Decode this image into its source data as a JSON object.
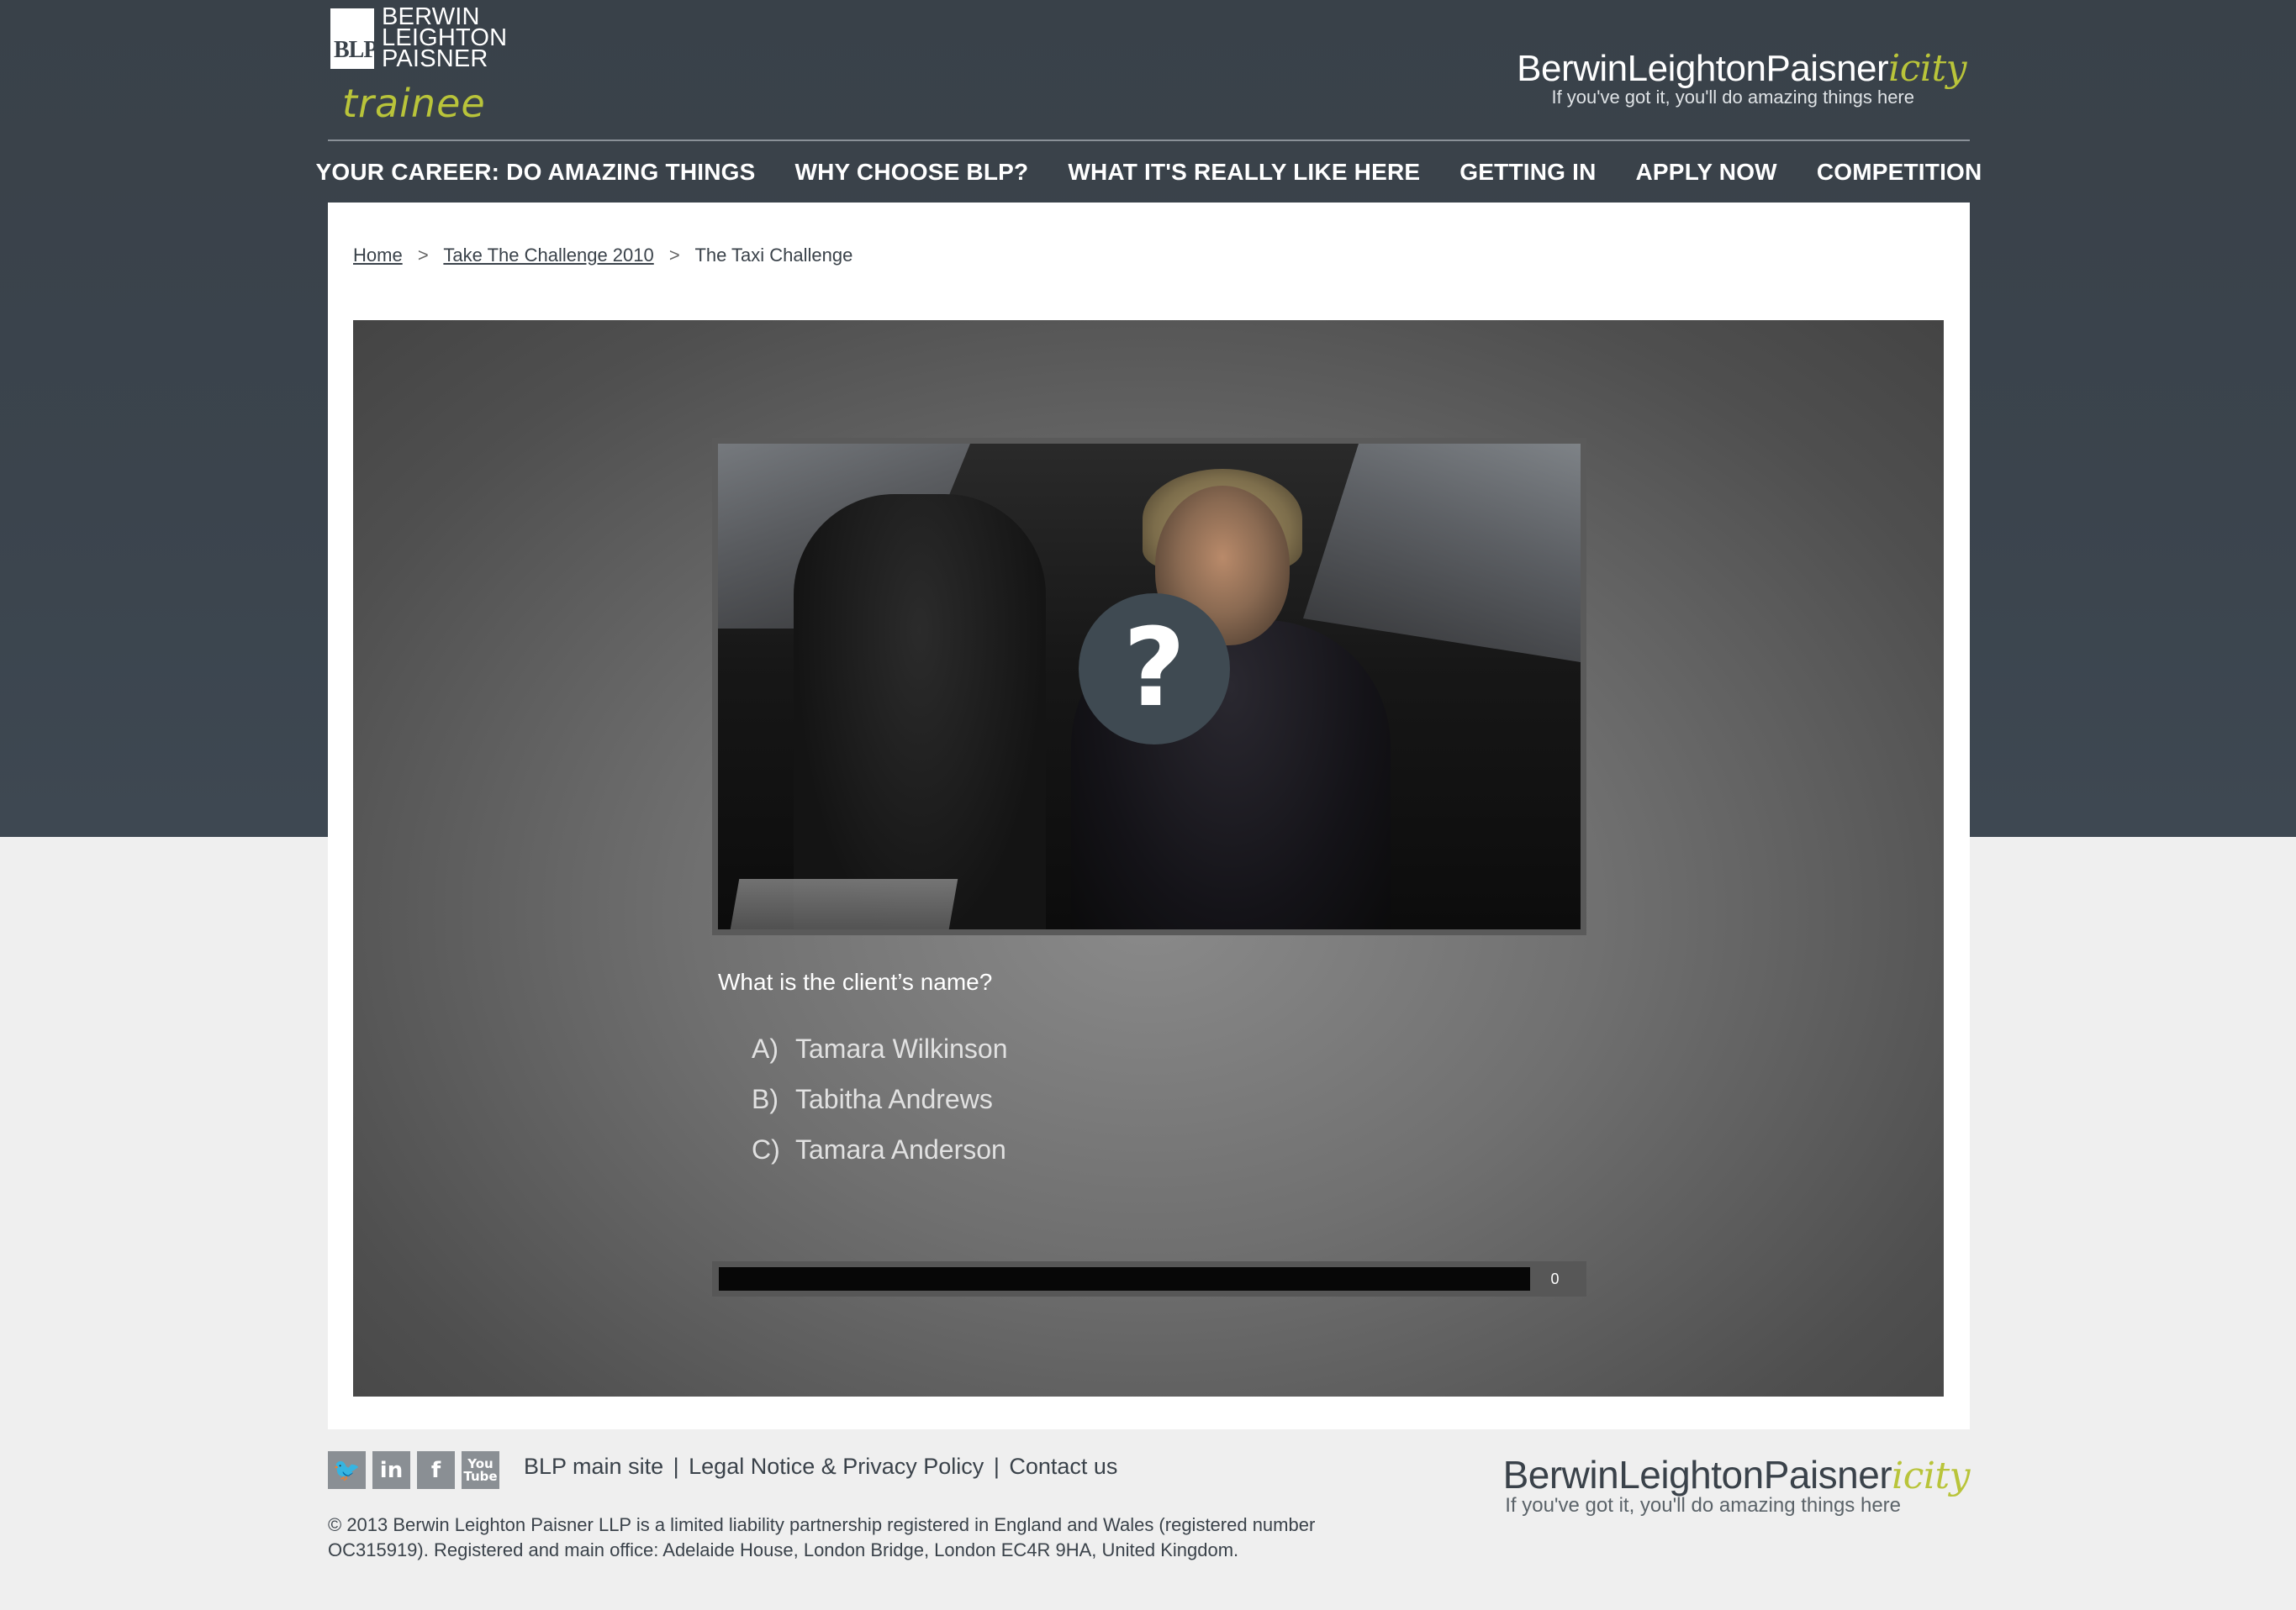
{
  "header": {
    "logo_box_text": "BLP",
    "logo_lines": [
      "BERWIN",
      "LEIGHTON",
      "PAISNER"
    ],
    "trainee_label": "trainee",
    "brand_name_main": "BerwinLeightonPaisner",
    "brand_name_accent": "icity",
    "brand_tagline": "If you've got it, you'll do amazing things here"
  },
  "nav": {
    "items": [
      {
        "label": "YOUR CAREER: DO AMAZING THINGS"
      },
      {
        "label": "WHY CHOOSE BLP?"
      },
      {
        "label": "WHAT IT'S REALLY LIKE HERE"
      },
      {
        "label": "GETTING IN"
      },
      {
        "label": "APPLY NOW"
      },
      {
        "label": "COMPETITION"
      }
    ]
  },
  "breadcrumb": {
    "home": "Home",
    "sep": ">",
    "parent": "Take The Challenge 2010",
    "current": "The Taxi Challenge"
  },
  "quiz": {
    "overlay_icon": "question-mark-icon",
    "overlay_glyph": "?",
    "question": "What is the client’s name?",
    "answers": [
      {
        "letter": "A)",
        "text": "Tamara Wilkinson"
      },
      {
        "letter": "B)",
        "text": "Tabitha Andrews"
      },
      {
        "letter": "C)",
        "text": "Tamara Anderson"
      }
    ],
    "progress_fraction": 0,
    "progress_count": "0"
  },
  "footer": {
    "social": [
      {
        "icon": "twitter-icon",
        "glyph": "🐦"
      },
      {
        "icon": "linkedin-icon",
        "glyph": "in"
      },
      {
        "icon": "facebook-icon",
        "glyph": "f"
      },
      {
        "icon": "youtube-icon",
        "glyph": "You Tube"
      }
    ],
    "links": [
      "BLP main site",
      "Legal Notice & Privacy Policy",
      "Contact us"
    ],
    "link_separator": "|",
    "legal_text": "© 2013 Berwin Leighton Paisner LLP is a limited liability partnership registered in England and Wales (registered number OC315919). Registered and main office: Adelaide House, London Bridge, London EC4R 9HA, United Kingdom.",
    "brand_name_main": "BerwinLeightonPaisner",
    "brand_name_accent": "icity",
    "brand_tagline": "If you've got it, you'll do amazing things here"
  },
  "colors": {
    "header_bg": "#3b444d",
    "accent": "#b9c43a",
    "text_dark": "#3a424a"
  }
}
